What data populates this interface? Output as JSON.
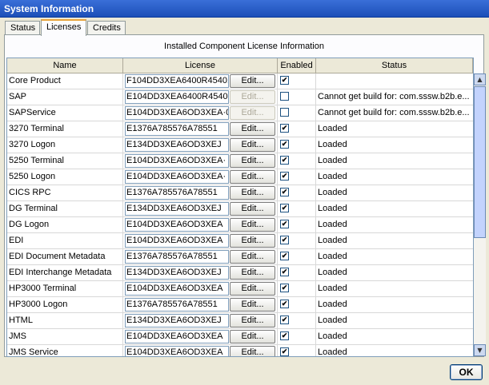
{
  "window": {
    "title": "System Information"
  },
  "tabs": [
    {
      "label": "Status",
      "active": false
    },
    {
      "label": "Licenses",
      "active": true
    },
    {
      "label": "Credits",
      "active": false
    }
  ],
  "panel": {
    "heading": "Installed Component License Information"
  },
  "table": {
    "columns": [
      "Name",
      "License",
      "Enabled",
      "Status"
    ],
    "edit_label": "Edit...",
    "check_mark": "✔",
    "rows": [
      {
        "name": "Core Product",
        "license": "F104DD3XEA6400R45401",
        "enabled": true,
        "edit_enabled": true,
        "status": ""
      },
      {
        "name": "SAP",
        "license": "E104DD3XEA6400R45401",
        "enabled": false,
        "edit_enabled": false,
        "status": "Cannot get build for: com.sssw.b2b.e..."
      },
      {
        "name": "SAPService",
        "license": "E104DD3XEA6OD3XEA·01",
        "enabled": false,
        "edit_enabled": false,
        "status": "Cannot get build for: com.sssw.b2b.e..."
      },
      {
        "name": "3270 Terminal",
        "license": "E1376A785576A78551",
        "enabled": true,
        "edit_enabled": true,
        "status": "Loaded"
      },
      {
        "name": "3270 Logon",
        "license": "E134DD3XEA6OD3XEJ",
        "enabled": true,
        "edit_enabled": true,
        "status": "Loaded"
      },
      {
        "name": "5250 Terminal",
        "license": "E104DD3XEA6OD3XEA·",
        "enabled": true,
        "edit_enabled": true,
        "status": "Loaded"
      },
      {
        "name": "5250 Logon",
        "license": "E104DD3XEA6OD3XEA·",
        "enabled": true,
        "edit_enabled": true,
        "status": "Loaded"
      },
      {
        "name": "CICS RPC",
        "license": "E1376A785576A78551",
        "enabled": true,
        "edit_enabled": true,
        "status": "Loaded"
      },
      {
        "name": "DG Terminal",
        "license": "E134DD3XEA6OD3XEJ",
        "enabled": true,
        "edit_enabled": true,
        "status": "Loaded"
      },
      {
        "name": "DG Logon",
        "license": "E104DD3XEA6OD3XEA",
        "enabled": true,
        "edit_enabled": true,
        "status": "Loaded"
      },
      {
        "name": "EDI",
        "license": "E104DD3XEA6OD3XEA",
        "enabled": true,
        "edit_enabled": true,
        "status": "Loaded"
      },
      {
        "name": "EDI Document Metadata",
        "license": "E1376A785576A78551",
        "enabled": true,
        "edit_enabled": true,
        "status": "Loaded"
      },
      {
        "name": "EDI Interchange Metadata",
        "license": "E134DD3XEA6OD3XEJ",
        "enabled": true,
        "edit_enabled": true,
        "status": "Loaded"
      },
      {
        "name": "HP3000 Terminal",
        "license": "E104DD3XEA6OD3XEA",
        "enabled": true,
        "edit_enabled": true,
        "status": "Loaded"
      },
      {
        "name": "HP3000 Logon",
        "license": "E1376A785576A78551",
        "enabled": true,
        "edit_enabled": true,
        "status": "Loaded"
      },
      {
        "name": "HTML",
        "license": "E134DD3XEA6OD3XEJ",
        "enabled": true,
        "edit_enabled": true,
        "status": "Loaded"
      },
      {
        "name": "JMS",
        "license": "E104DD3XEA6OD3XEA",
        "enabled": true,
        "edit_enabled": true,
        "status": "Loaded"
      },
      {
        "name": "JMS Service",
        "license": "E104DD3XEA6OD3XEA",
        "enabled": true,
        "edit_enabled": true,
        "status": "Loaded"
      }
    ]
  },
  "scrollbar": {
    "up_glyph": "▲",
    "down_glyph": "▼"
  },
  "footer": {
    "ok_label": "OK"
  }
}
